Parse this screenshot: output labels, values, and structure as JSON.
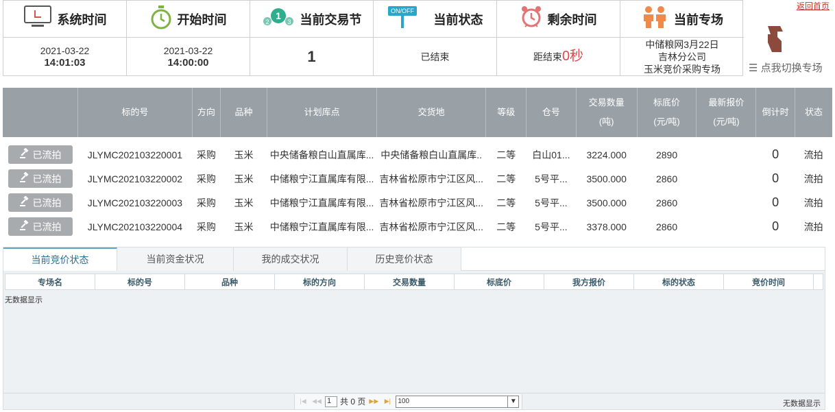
{
  "back_link": "返回首页",
  "info": {
    "system_time": {
      "title": "系统时间",
      "date": "2021-03-22",
      "time": "14:01:03",
      "icon": "monitor-icon"
    },
    "start_time": {
      "title": "开始时间",
      "date": "2021-03-22",
      "time": "14:00:00",
      "icon": "stopwatch-icon"
    },
    "session": {
      "title": "当前交易节",
      "value": "1",
      "icon": "steps-icon",
      "badge": "1",
      "small_left": "2",
      "small_right": "3"
    },
    "status": {
      "title": "当前状态",
      "value": "已结束",
      "icon": "onoff-icon",
      "badge": "ON/OFF"
    },
    "remaining": {
      "title": "剩余时间",
      "prefix": "距结束",
      "seconds": "0秒",
      "icon": "alarm-clock-icon"
    },
    "zone": {
      "title": "当前专场",
      "line1": "中储粮网3月22日",
      "line2": "吉林分公司",
      "line3": "玉米竞价采购专场",
      "icon": "people-icon"
    }
  },
  "switch_zone": {
    "label": "点我切换专场",
    "icon": "pointing-hand-icon"
  },
  "table": {
    "headers": {
      "code": "标的号",
      "direction": "方向",
      "variety": "品种",
      "plan_store": "计划库点",
      "delivery": "交货地",
      "grade": "等级",
      "warehouse": "仓号",
      "qty_1": "交易数量",
      "qty_2": "(吨)",
      "floor_1": "标底价",
      "floor_2": "(元/吨)",
      "latest_1": "最新报价",
      "latest_2": "(元/吨)",
      "countdown": "倒计时",
      "status": "状态"
    },
    "rows": [
      {
        "button": "已流拍",
        "code": "JLYMC202103220001",
        "direction": "采购",
        "variety": "玉米",
        "plan_store": "中央储备粮白山直属库...",
        "delivery": "中央储备粮白山直属库..",
        "grade": "二等",
        "warehouse": "白山01...",
        "qty": "3224.000",
        "floor": "2890",
        "latest": "",
        "countdown": "0",
        "status": "流拍"
      },
      {
        "button": "已流拍",
        "code": "JLYMC202103220002",
        "direction": "采购",
        "variety": "玉米",
        "plan_store": "中储粮宁江直属库有限...",
        "delivery": "吉林省松原市宁江区风...",
        "grade": "二等",
        "warehouse": "5号平...",
        "qty": "3500.000",
        "floor": "2860",
        "latest": "",
        "countdown": "0",
        "status": "流拍"
      },
      {
        "button": "已流拍",
        "code": "JLYMC202103220003",
        "direction": "采购",
        "variety": "玉米",
        "plan_store": "中储粮宁江直属库有限...",
        "delivery": "吉林省松原市宁江区风...",
        "grade": "二等",
        "warehouse": "5号平...",
        "qty": "3500.000",
        "floor": "2860",
        "latest": "",
        "countdown": "0",
        "status": "流拍"
      },
      {
        "button": "已流拍",
        "code": "JLYMC202103220004",
        "direction": "采购",
        "variety": "玉米",
        "plan_store": "中储粮宁江直属库有限...",
        "delivery": "吉林省松原市宁江区风...",
        "grade": "二等",
        "warehouse": "5号平...",
        "qty": "3378.000",
        "floor": "2860",
        "latest": "",
        "countdown": "0",
        "status": "流拍"
      }
    ]
  },
  "tabs": [
    "当前竞价状态",
    "当前资金状况",
    "我的成交状况",
    "历史竞价状态"
  ],
  "grid": {
    "columns": [
      "专场名",
      "标的号",
      "品种",
      "标的方向",
      "交易数量",
      "标底价",
      "我方报价",
      "标的状态",
      "竞价时间"
    ],
    "empty_text": "无数据显示"
  },
  "pager": {
    "page_input": "1",
    "total_pages": "共 0 页",
    "page_size": "100",
    "right_text": "无数据显示"
  },
  "colors": {
    "header_bg": "#9aa1a6",
    "accent_red": "#e0474c",
    "direction_orange": "#f0a030",
    "tab_active": "#2f6f8f"
  }
}
